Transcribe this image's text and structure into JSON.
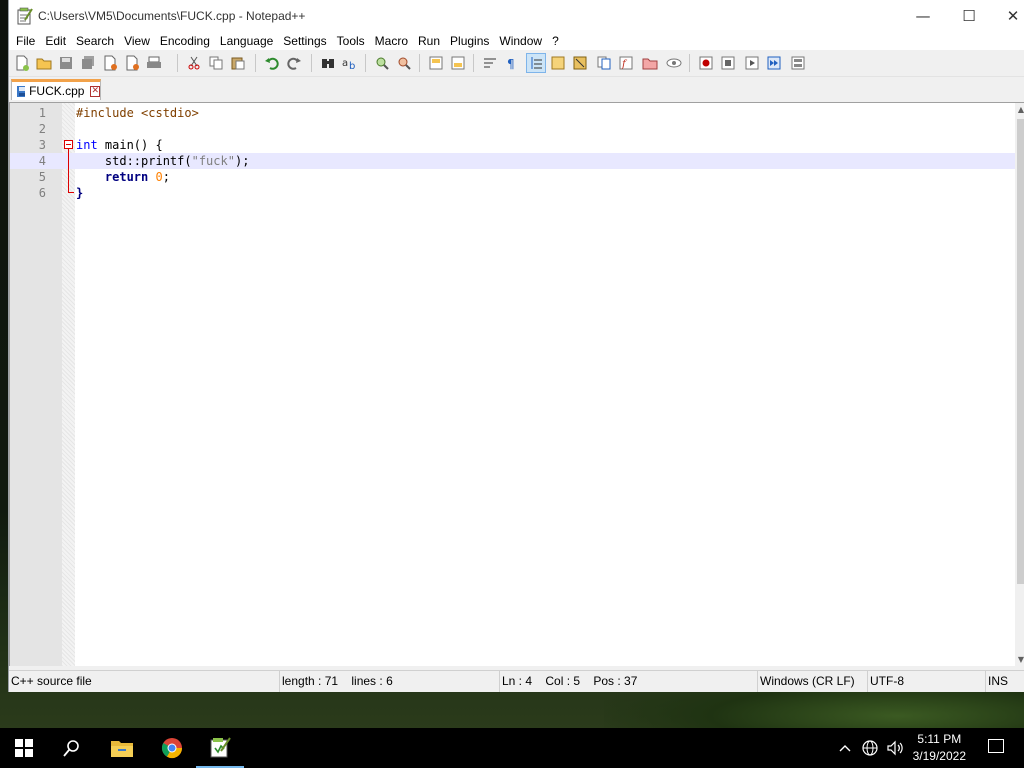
{
  "window": {
    "title": "C:\\Users\\VM5\\Documents\\FUCK.cpp - Notepad++",
    "min_glyph": "—",
    "max_glyph": "☐",
    "close_glyph": "✕"
  },
  "menu": [
    "File",
    "Edit",
    "Search",
    "View",
    "Encoding",
    "Language",
    "Settings",
    "Tools",
    "Macro",
    "Run",
    "Plugins",
    "Window",
    "?"
  ],
  "tab": {
    "label": "FUCK.cpp",
    "close_glyph": "✕"
  },
  "editor": {
    "lines": [
      {
        "num": "1"
      },
      {
        "num": "2"
      },
      {
        "num": "3"
      },
      {
        "num": "4"
      },
      {
        "num": "5"
      },
      {
        "num": "6"
      }
    ],
    "tokens": {
      "include": "#include",
      "header": " <cstdio>",
      "int": "int",
      "main": " main() {",
      "std": "std::printf(",
      "str": "\"fuck\"",
      "end_call": ");",
      "ret": "return",
      "zero": "0",
      "semi": ";",
      "close": "}"
    },
    "current_line": "4"
  },
  "status": {
    "type": "C++ source file",
    "length": "length : 71    lines : 6",
    "position": "Ln : 4    Col : 5    Pos : 37",
    "eol": "Windows (CR LF)",
    "encoding": "UTF-8",
    "mode": "INS"
  },
  "taskbar": {
    "time": "5:11 PM",
    "date": "3/19/2022"
  },
  "colors": {
    "tab_accent": "#f2a24a",
    "current_line": "#e8e8ff",
    "fold_marker": "#dd0000",
    "keyword": "#0000ff",
    "preprocessor": "#804000",
    "number": "#ff8000"
  }
}
